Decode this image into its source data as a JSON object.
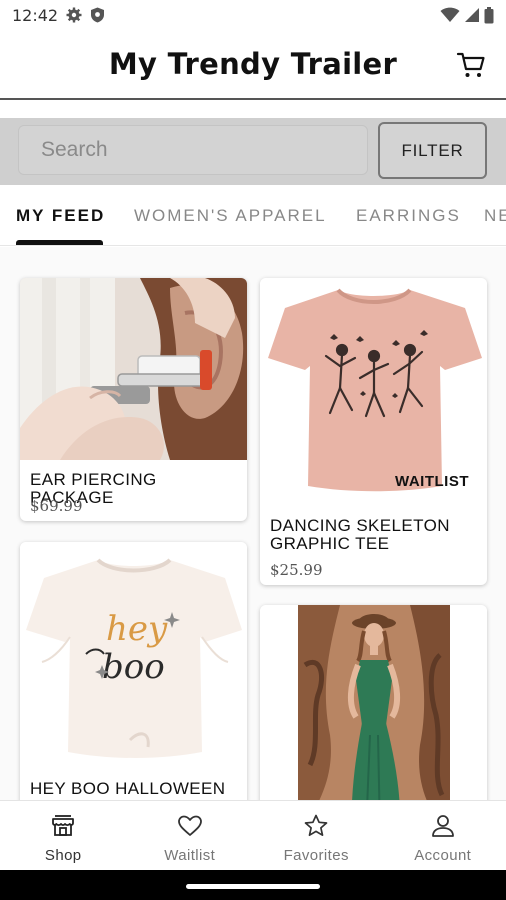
{
  "status_bar": {
    "time": "12:42",
    "left_icons": [
      "gear-icon",
      "shield-icon"
    ],
    "right_icons": [
      "wifi-icon",
      "signal-icon",
      "battery-icon"
    ]
  },
  "header": {
    "title": "My Trendy Trailer",
    "cart_icon": "cart-icon"
  },
  "search": {
    "placeholder": "Search",
    "value": "",
    "filter_label": "FILTER"
  },
  "tabs": [
    {
      "label": "MY FEED",
      "active": true
    },
    {
      "label": "WOMEN'S APPAREL",
      "active": false
    },
    {
      "label": "EARRINGS",
      "active": false
    },
    {
      "label": "NE",
      "active": false
    }
  ],
  "products": [
    {
      "title": "EAR PIERCING PACKAGE",
      "price": "$69.99",
      "badge": ""
    },
    {
      "title": "DANCING SKELETON GRAPHIC TEE",
      "price": "$25.99",
      "badge": "WAITLIST"
    },
    {
      "title": "HEY BOO HALLOWEEN GRAPHIC TEE",
      "price": "",
      "badge": "",
      "shirt_text_1": "hey",
      "shirt_text_2": "boo"
    },
    {
      "title": "",
      "price": "",
      "badge": ""
    }
  ],
  "bottom_nav": [
    {
      "label": "Shop",
      "icon": "shop-icon",
      "active": true
    },
    {
      "label": "Waitlist",
      "icon": "heart-icon",
      "active": false
    },
    {
      "label": "Favorites",
      "icon": "star-icon",
      "active": false
    },
    {
      "label": "Account",
      "icon": "account-icon",
      "active": false
    }
  ],
  "colors": {
    "search_strip": "#cfcfcf",
    "tab_indicator": "#111111",
    "tee_pink": "#e8b4a6",
    "dress_green": "#2e7a55"
  }
}
